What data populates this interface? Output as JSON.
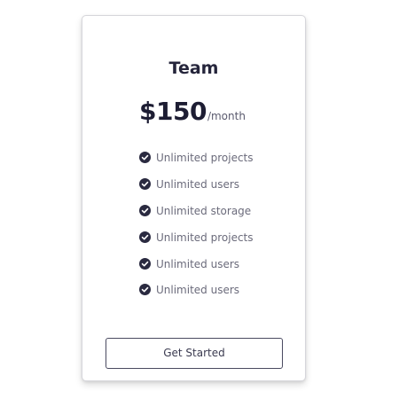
{
  "plan": {
    "name": "Team",
    "price": "$150",
    "period": "/month",
    "features": [
      {
        "label": "Unlimited projects",
        "icon": "check-circle-icon"
      },
      {
        "label": "Unlimited users",
        "icon": "check-circle-icon"
      },
      {
        "label": "Unlimited storage",
        "icon": "check-circle-icon"
      },
      {
        "label": "Unlimited projects",
        "icon": "check-circle-icon"
      },
      {
        "label": "Unlimited users",
        "icon": "check-circle-icon"
      },
      {
        "label": "Unlimited users",
        "icon": "check-circle-icon"
      }
    ],
    "cta_label": "Get Started"
  },
  "colors": {
    "text_dark": "#25253b",
    "check": "#2a2a40",
    "border": "#d6d6db"
  }
}
